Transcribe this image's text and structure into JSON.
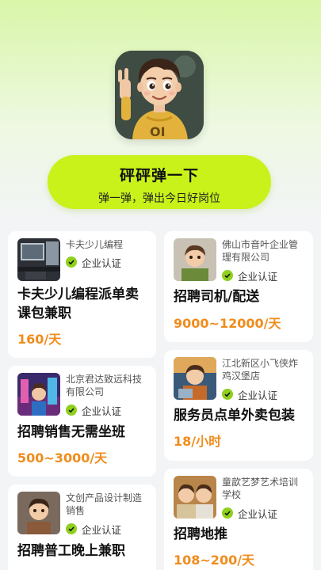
{
  "banner": {
    "title": "砰砰弹一下",
    "subtitle": "弹一弹，弹出今日好岗位"
  },
  "cards_left": [
    {
      "company": "卡夫少儿编程",
      "verified": "企业认证",
      "job": "卡夫少儿编程派单卖课包兼职",
      "salary": "160/天",
      "thumb": "computer-desk-photo"
    },
    {
      "company": "北京君达致远科技有限公司",
      "verified": "企业认证",
      "job": "招聘销售无需坐班",
      "salary": "500~3000/天",
      "thumb": "neon-city-photo"
    },
    {
      "company": "文创产品设计制造销售",
      "verified": "企业认证",
      "job": "招聘普工晚上兼职",
      "salary": "",
      "thumb": "cartoon-boy-photo"
    }
  ],
  "cards_right": [
    {
      "company": "佛山市音叶企业管理有限公司",
      "verified": "企业认证",
      "job": "招聘司机/配送",
      "salary": "9000~12000/天",
      "thumb": "cartoon-boy-green-photo"
    },
    {
      "company": "江北新区小飞侠炸鸡汉堡店",
      "verified": "企业认证",
      "job": "服务员点单外卖包装",
      "salary": "18/小时",
      "thumb": "cartoon-boy-laptop-photo"
    },
    {
      "company": "童歆艺梦艺术培训学校",
      "verified": "企业认证",
      "job": "招聘地推",
      "salary": "108~200/天",
      "thumb": "cartoon-kids-photo"
    }
  ],
  "colors": {
    "accent_button": "#c8f21a",
    "salary": "#f08c1c",
    "verify_check": "#8fcf1e"
  }
}
